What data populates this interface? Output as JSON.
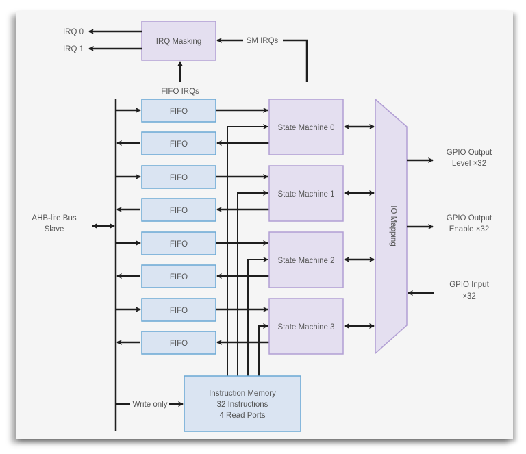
{
  "irq": {
    "masking_label": "IRQ Masking",
    "out0": "IRQ 0",
    "out1": "IRQ 1",
    "sm_irqs": "SM IRQs",
    "fifo_irqs": "FIFO IRQs"
  },
  "bus": {
    "line1": "AHB-lite Bus",
    "line2": "Slave",
    "write_only": "Write only"
  },
  "fifos": [
    "FIFO",
    "FIFO",
    "FIFO",
    "FIFO",
    "FIFO",
    "FIFO",
    "FIFO",
    "FIFO"
  ],
  "state_machines": [
    "State Machine 0",
    "State Machine 1",
    "State Machine 2",
    "State Machine 3"
  ],
  "io_mapping": "IO Mapping",
  "instruction_memory": {
    "line1": "Instruction Memory",
    "line2": "32 Instructions",
    "line3": "4 Read Ports"
  },
  "gpio": {
    "out_level_1": "GPIO Output",
    "out_level_2": "Level ×32",
    "out_enable_1": "GPIO Output",
    "out_enable_2": "Enable ×32",
    "input_1": "GPIO Input",
    "input_2": "×32"
  }
}
